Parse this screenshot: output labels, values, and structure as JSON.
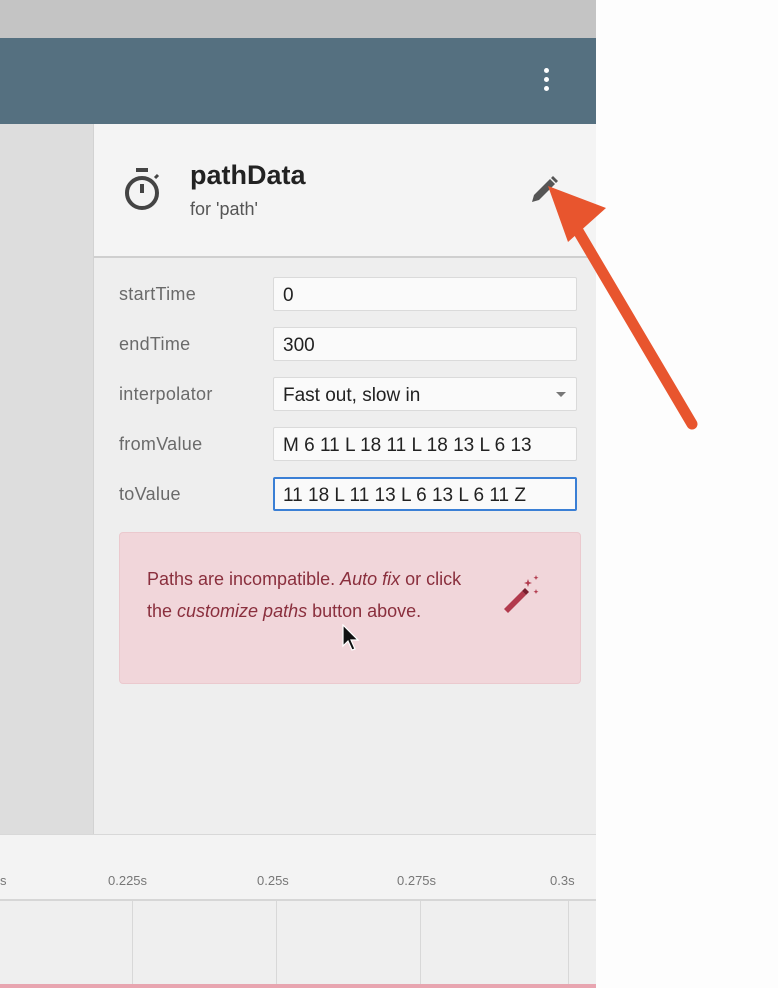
{
  "toolbar": {
    "menu_icon": "more-vert-icon"
  },
  "inspector": {
    "header": {
      "icon": "stopwatch-icon",
      "title": "pathData",
      "subtitle": "for 'path'",
      "edit_icon": "pencil-icon"
    },
    "properties": [
      {
        "label": "startTime",
        "value": "0"
      },
      {
        "label": "endTime",
        "value": "300"
      },
      {
        "label": "interpolator",
        "value": "Fast out, slow in"
      },
      {
        "label": "fromValue",
        "value": "M 6 11 L 18 11 L 18 13 L 6 13"
      },
      {
        "label": "toValue",
        "value": "11 18 L 11 13 L 6 13 L 6 11 Z"
      }
    ],
    "alert": {
      "part1": "Paths are incompatible. ",
      "link1": "Auto fix",
      "part2": " or click the ",
      "link2": "customize paths",
      "part3": " button above.",
      "icon": "magic-wand-icon"
    }
  },
  "timeline": {
    "ticks": [
      "0.225s",
      "0.25s",
      "0.275s",
      "0.3s"
    ],
    "partial_tick": "s"
  },
  "colors": {
    "toolbar": "#557080",
    "alert_bg": "#f1d6da",
    "alert_text": "#8a2f3d",
    "focus": "#3a7fd5",
    "annotation_arrow": "#e8552e"
  }
}
